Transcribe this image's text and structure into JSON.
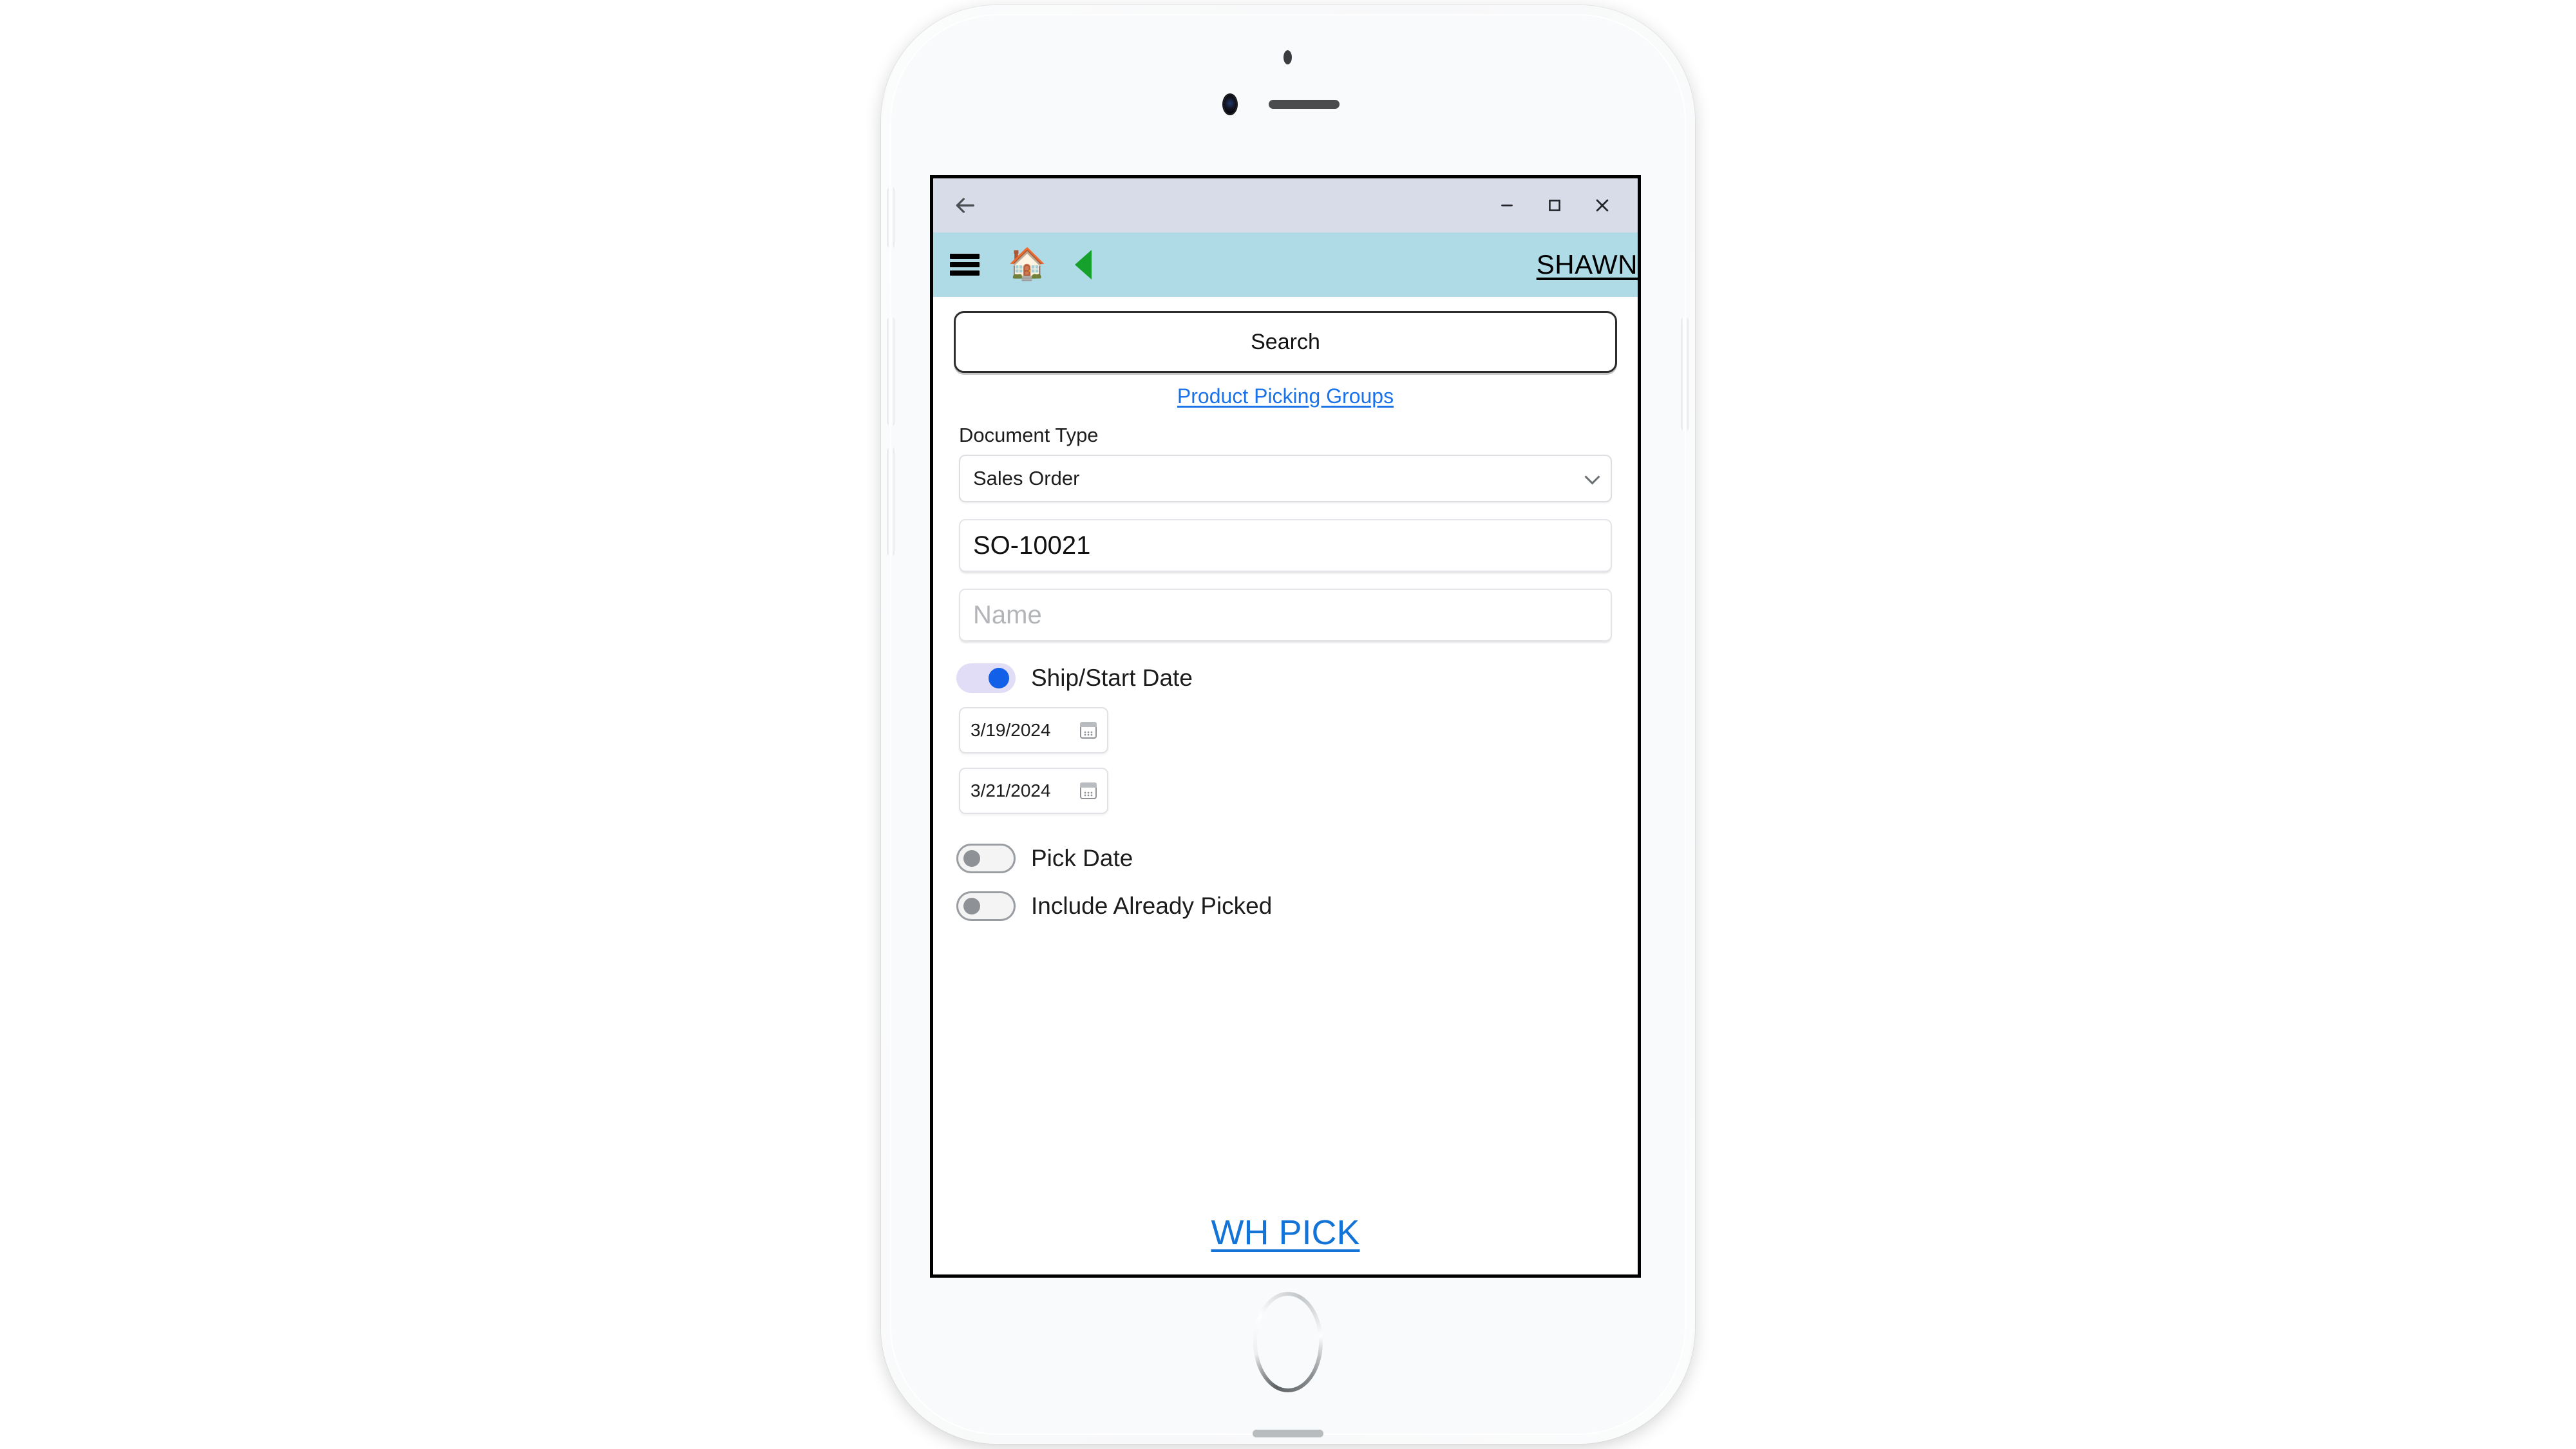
{
  "window": {
    "back_icon": "back-arrow-icon",
    "minimize_label": "–",
    "maximize_label": "□",
    "close_label": "✕"
  },
  "appbar": {
    "menu_icon": "hamburger-menu-icon",
    "home_icon": "🏠",
    "back_icon": "green-left-triangle-icon",
    "user": "SHAWN"
  },
  "main": {
    "search_label": "Search",
    "product_picking_groups_link": "Product Picking Groups",
    "document_type_label": "Document Type",
    "document_type_value": "Sales Order",
    "document_type_options": [
      "Sales Order"
    ],
    "order_number_value": "SO-10021",
    "order_number_placeholder": "",
    "name_value": "",
    "name_placeholder": "Name",
    "ship_start_date_label": "Ship/Start Date",
    "ship_start_date_on": true,
    "date_from": "3/19/2024",
    "date_to": "3/21/2024",
    "pick_date_label": "Pick Date",
    "pick_date_on": false,
    "include_already_picked_label": "Include Already Picked",
    "include_already_picked_on": false,
    "wh_pick_label": "WH PICK"
  },
  "colors": {
    "appbar_bg": "#aedbe6",
    "titlebar_bg": "#d7dce8",
    "link_blue": "#1a73e8",
    "wh_pick_blue": "#1373d6",
    "toggle_on_track": "#e2ddf6",
    "toggle_on_knob": "#1260e8",
    "green_triangle": "#16a02c"
  }
}
